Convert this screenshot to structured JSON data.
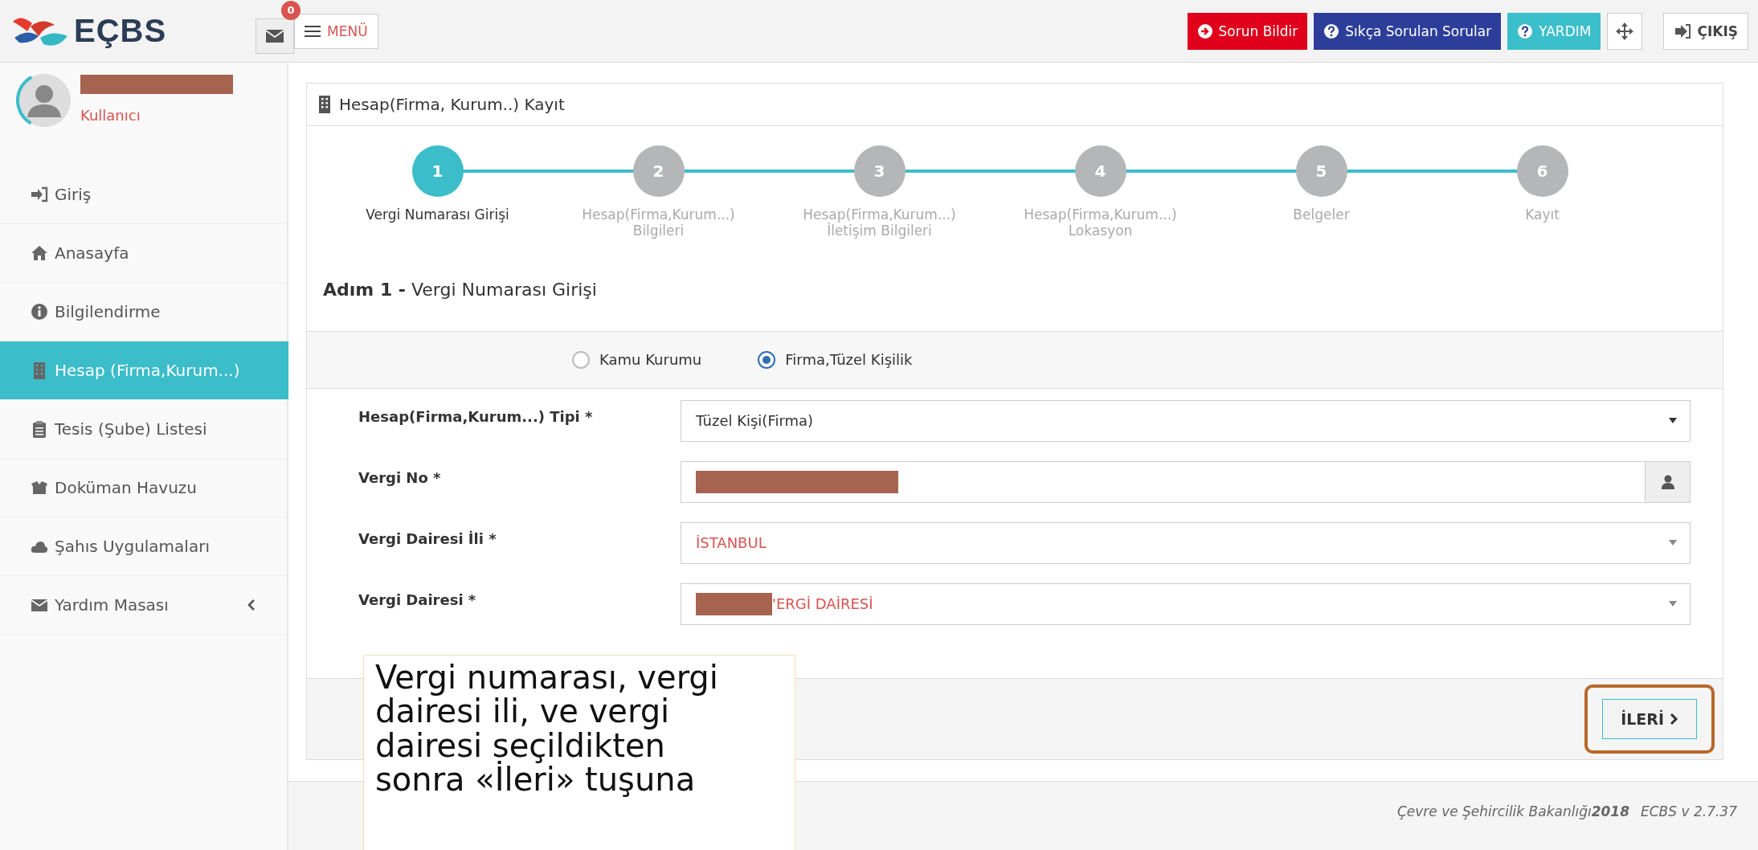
{
  "header": {
    "logo_text": "EÇBS",
    "mail_badge": "0",
    "menu_label": "MENÜ",
    "buttons": [
      {
        "label": "Sorun Bildir",
        "kind": "danger"
      },
      {
        "label": "Sıkça Sorulan Sorular",
        "kind": "primary"
      },
      {
        "label": "YARDIM",
        "kind": "info"
      }
    ],
    "exit_label": "ÇIKIŞ"
  },
  "user": {
    "role": "Kullanıcı",
    "redacted": true
  },
  "sidebar": {
    "items": [
      {
        "label": "Giriş",
        "selected": false,
        "submenu": false
      },
      {
        "label": "Anasayfa",
        "selected": false,
        "submenu": false
      },
      {
        "label": "Bilgilendirme",
        "selected": false,
        "submenu": false
      },
      {
        "label": "Hesap (Firma,Kurum...)",
        "selected": true,
        "submenu": false
      },
      {
        "label": "Tesis (Şube) Listesi",
        "selected": false,
        "submenu": false
      },
      {
        "label": "Doküman Havuzu",
        "selected": false,
        "submenu": false
      },
      {
        "label": "Şahıs Uygulamaları",
        "selected": false,
        "submenu": false
      },
      {
        "label": "Yardım Masası",
        "selected": false,
        "submenu": true
      }
    ]
  },
  "panel": {
    "title": "Hesap(Firma, Kurum..) Kayıt",
    "steps": [
      {
        "number": "1",
        "label": "Vergi Numarası Girişi",
        "selected": true
      },
      {
        "number": "2",
        "label": "Hesap(Firma,Kurum...)\nBilgileri",
        "selected": false
      },
      {
        "number": "3",
        "label": "Hesap(Firma,Kurum...)\nİletişim Bilgileri",
        "selected": false
      },
      {
        "number": "4",
        "label": "Hesap(Firma,Kurum...)\nLokasyon",
        "selected": false
      },
      {
        "number": "5",
        "label": "Belgeler",
        "selected": false
      },
      {
        "number": "6",
        "label": "Kayıt",
        "selected": false
      }
    ],
    "heading": "**Adım 1 -** Vergi Numarası Girişi",
    "radios": [
      {
        "label": "Kamu Kurumu",
        "selected": false
      },
      {
        "label": "Firma,Tüzel Kişilik",
        "selected": true
      }
    ],
    "fields": [
      {
        "label": "Hesap(Firma,Kurum...) Tipi *",
        "kind": "select",
        "value": "Tüzel Kişi(Firma)",
        "highlighted": false
      },
      {
        "label": "Vergi No *",
        "kind": "addon",
        "redacted": true
      },
      {
        "label": "Vergi Dairesi İli *",
        "kind": "select",
        "value": "İSTANBUL",
        "highlighted": true
      },
      {
        "label": "Vergi Dairesi *",
        "kind": "select",
        "value": "'ERGİ DAİRESİ",
        "highlighted": true,
        "redacted": true
      }
    ],
    "next_button": "İLERİ"
  },
  "footer": {
    "copyright": "Çevre ve Şehircilik Bakanlığı**2018**",
    "version": "ECBS v 2.7.37"
  },
  "callout": {
    "text": "Vergi numarası, vergi dairesi ili, ve vergi dairesi seçildikten sonra «İleri» tuşuna"
  }
}
